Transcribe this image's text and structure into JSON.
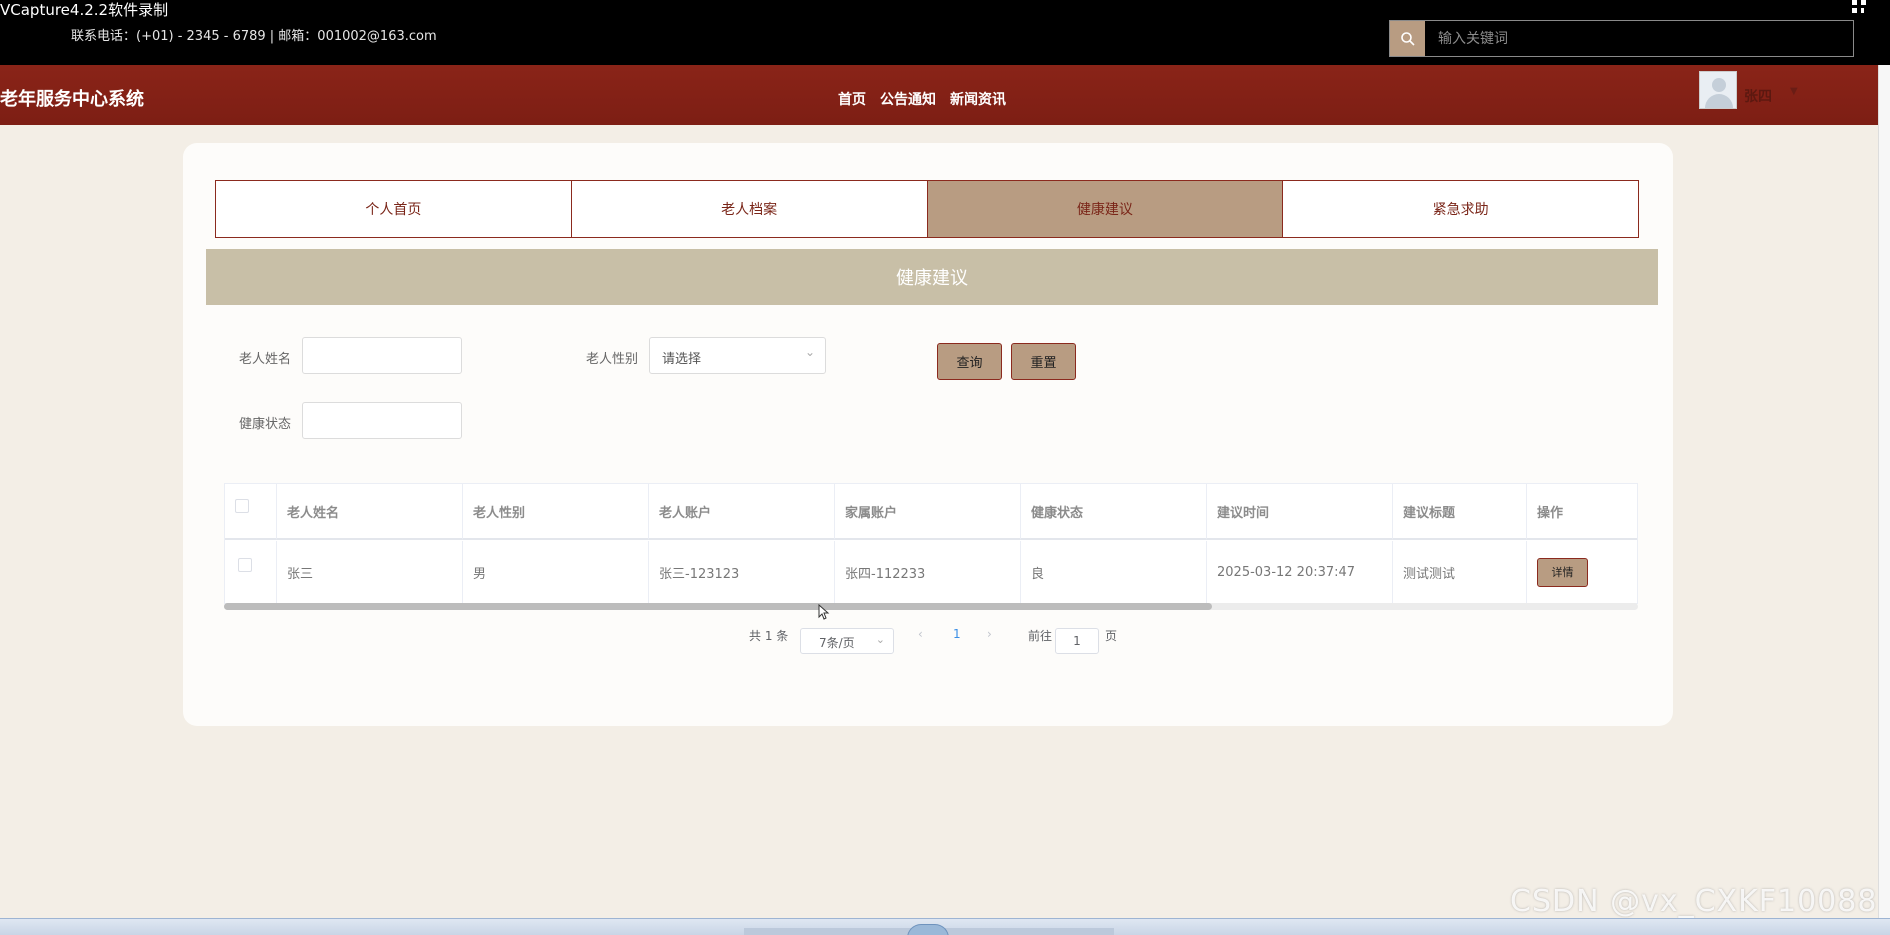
{
  "recorder_title": "VCapture4.2.2软件录制",
  "contact": "联系电话：(+01) - 2345 - 6789 | 邮箱：001002@163.com",
  "search": {
    "placeholder": "输入关键词"
  },
  "site_title": "老年服务中心系统",
  "nav": [
    "首页",
    "公告通知",
    "新闻资讯"
  ],
  "user": {
    "name": "张四"
  },
  "tabs": [
    "个人首页",
    "老人档案",
    "健康建议",
    "紧急求助"
  ],
  "active_tab": "健康建议",
  "section_title": "健康建议",
  "filters": {
    "name_label": "老人姓名",
    "gender_label": "老人性别",
    "gender_placeholder": "请选择",
    "health_label": "健康状态",
    "query_button": "查询",
    "reset_button": "重置"
  },
  "table": {
    "headers": [
      "老人姓名",
      "老人性别",
      "老人账户",
      "家属账户",
      "健康状态",
      "建议时间",
      "建议标题",
      "操作"
    ],
    "rows": [
      {
        "name": "张三",
        "gender": "男",
        "account": "张三-123123",
        "family": "张四-112233",
        "health": "良",
        "time": "2025-03-12 20:37:47",
        "title": "测试测试",
        "action": "详情"
      }
    ]
  },
  "pagination": {
    "total": "共 1 条",
    "page_size": "7条/页",
    "current_page": "1",
    "goto_label": "前往",
    "goto_value": "1",
    "page_suffix": "页"
  },
  "watermark": "CSDN @vx_CXKF10088",
  "colors": {
    "accent": "#b89c82",
    "nav": "#8a2418",
    "header_band": "#c8bfa7"
  }
}
